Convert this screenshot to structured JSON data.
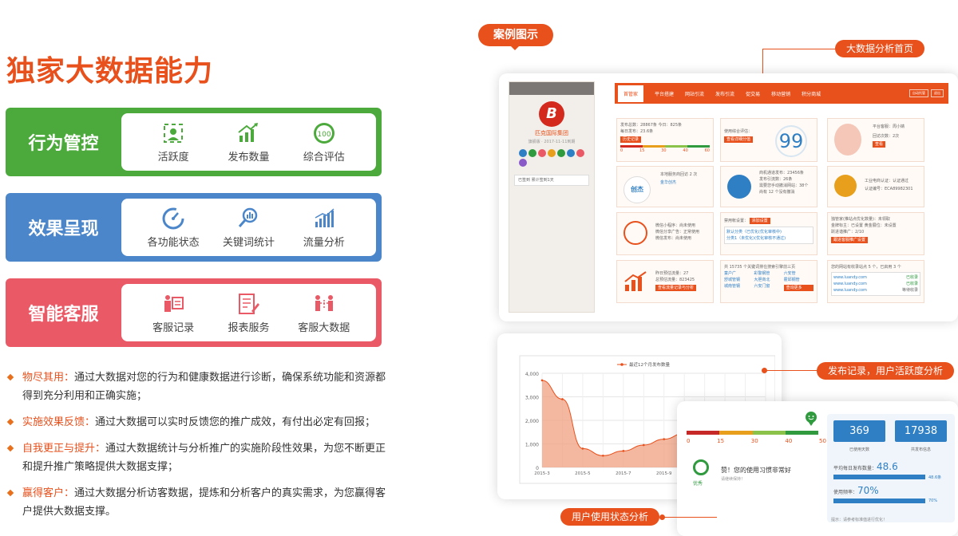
{
  "title": "独家大数据能力",
  "cards": [
    {
      "label": "行为管控",
      "color": "#4caa3c",
      "features": [
        {
          "icon": "activity-icon",
          "label": "活跃度"
        },
        {
          "icon": "bar-growth-icon",
          "label": "发布数量"
        },
        {
          "icon": "score-100-icon",
          "label": "综合评估",
          "badge": "100"
        }
      ]
    },
    {
      "label": "效果呈现",
      "color": "#4a86c9",
      "features": [
        {
          "icon": "gauge-icon",
          "label": "各功能状态"
        },
        {
          "icon": "magnifier-chart-icon",
          "label": "关键词统计"
        },
        {
          "icon": "traffic-bars-icon",
          "label": "流量分析"
        }
      ]
    },
    {
      "label": "智能客服",
      "color": "#ea5a66",
      "features": [
        {
          "icon": "agent-record-icon",
          "label": "客服记录"
        },
        {
          "icon": "report-edit-icon",
          "label": "报表服务"
        },
        {
          "icon": "people-network-icon",
          "label": "客服大数据"
        }
      ]
    }
  ],
  "bullets": [
    {
      "title": "物尽其用：",
      "text": "通过大数据对您的行为和健康数据进行诊断，确保系统功能和资源都得到充分利用和正确实施；"
    },
    {
      "title": "实施效果反馈：",
      "text": "通过大数据可以实时反馈您的推广成效，有付出必定有回报；"
    },
    {
      "title": "自我更正与提升：",
      "text": "通过大数据统计与分析推广的实施阶段性效果，为您不断更正和提升推广策略提供大数据支撑；"
    },
    {
      "title": "赢得客户：",
      "text": "通过大数据分析访客数据，提炼和分析客户的真实需求，为您赢得客户提供大数据支撑。"
    }
  ],
  "case_tag": "案例图示",
  "callouts": {
    "home": "大数据分析首页",
    "publish": "发布记录，用户活跃度分析",
    "usage": "用户使用状态分析"
  },
  "dashboard": {
    "company": "匹克国际集团",
    "sub": "旗舰版 · 2017-11-11到期",
    "sign": "已签到  累计签到1天",
    "logo_letter": "B",
    "nav": [
      "首管家",
      "平台搭建",
      "网站引流",
      "发布引流",
      "促交易",
      "移动营销",
      "积分商城"
    ],
    "nav_right": [
      "自动托管",
      "退出"
    ],
    "boxes": {
      "publish": [
        "发布总数：28867条  今日：825条",
        "每日发布：23.6条",
        "历史记录"
      ],
      "publish_ticks": [
        "0",
        "15",
        "30",
        "40",
        "60"
      ],
      "usage_label": "使用综合评估：",
      "usage_btn": "查看详细分值",
      "usage_score": "99",
      "manager": [
        "平台客服：周小婧",
        "回访次数：2次",
        "查看"
      ],
      "service": [
        "本地服务商回访 2 次",
        "金华创杰"
      ],
      "service_logo": "创杰",
      "website": [
        "商机通道发布：23456条",
        "发布引流数：26条",
        "需要您手动撤消网站：38个",
        "尚有 12 个没有撤消"
      ],
      "cert": [
        "工业电商认证：认证通过",
        "认证编号：ECA89982301"
      ],
      "wechat": [
        "微信小程序：尚未使用",
        "微信分享广告：正常使用",
        "微信发布：尚未使用"
      ],
      "risk": [
        "禁用帐设置：",
        "添加设置",
        "默认分类（已优化(优化审核中)",
        "分类1（未优化)(优化审核不通过)"
      ],
      "promo": [
        "独管家(推站点优化数量)：未领取",
        "金牌标主：已设置  黄金展位：未设置",
        "跃进谐推广：2/10",
        "跟进客服推广设置"
      ],
      "traffic": [
        "昨日预估流量：27",
        "总预估流量：823425",
        "查看流量记录与分析"
      ],
      "keywords_title": "共 15735 个关键词排在搜索引擎前三页",
      "keywords": [
        "童户广",
        "彩警钢管",
        "六安管",
        "舒城管钢",
        "大胆商北",
        "霍邱钢管",
        "城南管钢",
        "六安门窗",
        "查询更多"
      ],
      "seo_title": "您的网站有收录站点 5 个，已启用 3 个",
      "seo_rows": [
        {
          "url": "www.luandy.com",
          "status": "已收录"
        },
        {
          "url": "www.luandy.com",
          "status": "已收录"
        },
        {
          "url": "www.luandy.com",
          "status": "等待收录"
        }
      ]
    }
  },
  "chart_data": {
    "type": "area",
    "title": "",
    "series": [
      {
        "name": "最近12个月发布数量",
        "values": [
          3700,
          2900,
          800,
          500,
          700,
          950,
          1200,
          1450,
          1600,
          1550,
          1300,
          900
        ]
      }
    ],
    "x": [
      "2015-3",
      "2015-4",
      "2015-5",
      "2015-6",
      "2015-7",
      "2015-8",
      "2015-9",
      "2015-10",
      "2015-11",
      "2015-12",
      "2016-1",
      "2016-2"
    ],
    "x_tick_labels": [
      "2015-3",
      "2015-5",
      "2015-7",
      "2015-9",
      "2015-11",
      "2016-1"
    ],
    "y_ticks": [
      "4,000",
      "3,000",
      "2,000",
      "1,000",
      "0"
    ],
    "ylim": [
      0,
      4000
    ],
    "color": "#f0a080",
    "line_color": "#e8501c",
    "grid": true,
    "legend": "top-center"
  },
  "stats": {
    "ticks": [
      "0",
      "15",
      "30",
      "40",
      "50"
    ],
    "msg": "赞！您的使用习惯非常好",
    "sub": "请继续保持！",
    "grade": "优秀",
    "used_days": "369",
    "used_days_label": "已使用天数",
    "total_posts": "17938",
    "total_posts_label": "共发布信息",
    "avg_label": "平均每日发布数量：",
    "avg_value": "48.6",
    "avg_small": "48.6条",
    "freq_label": "使用频率：",
    "freq_value": "70%",
    "freq_small": "70%",
    "tip": "提示：请参考标准值进行优化！"
  }
}
